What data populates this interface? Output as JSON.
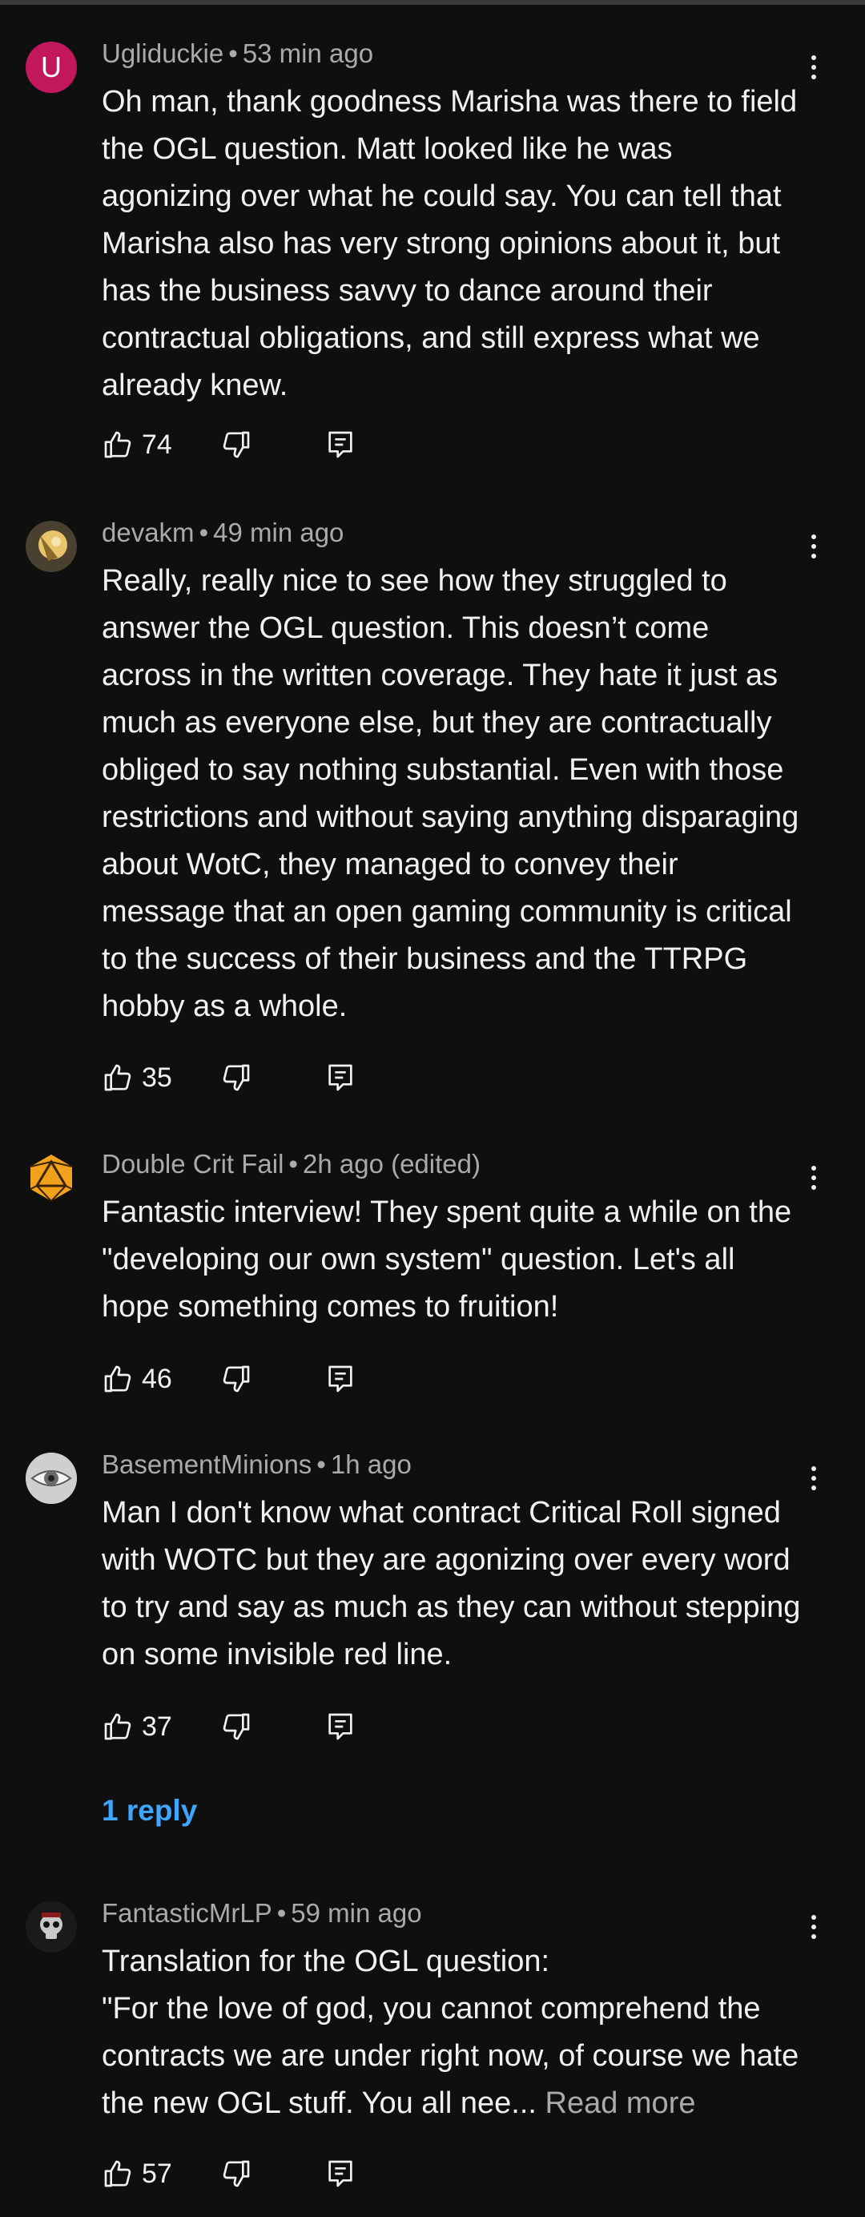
{
  "comments": [
    {
      "author": "Ugliduckie",
      "time": "53 min ago",
      "avatar_letter": "U",
      "text": "Oh man, thank goodness Marisha was there to field the OGL question. Matt looked like he was agonizing over what he could say. You can tell that Marisha also has very strong opinions about it, but has the business savvy to dance around their contractual obligations, and still express what we already knew.",
      "likes": "74"
    },
    {
      "author": "devakm",
      "time": "49 min ago",
      "text": "Really, really nice to see how they struggled to answer the OGL question. This doesn’t come across in the written coverage. They hate it just as much as everyone else, but they are contractually obliged to say nothing substantial. Even with those restrictions and without saying anything disparaging about WotC, they managed to convey their message that an open gaming community is critical to the success of their business and the TTRPG hobby as a whole.",
      "likes": "35"
    },
    {
      "author": "Double Crit Fail",
      "time": "2h ago (edited)",
      "text": "Fantastic interview! They spent quite a while on the \"developing our own system\" question. Let's all hope something comes to fruition!",
      "likes": "46"
    },
    {
      "author": "BasementMinions",
      "time": "1h ago",
      "text": "Man I don't know what contract Critical Roll signed with WOTC but they are agonizing over every word to try and say as much as they can without stepping on some invisible red line.",
      "likes": "37",
      "replies": "1 reply"
    },
    {
      "author": "FantasticMrLP",
      "time": "59 min ago",
      "text_line1": "Translation for the OGL question:",
      "text_rest": "\"For the love of god, you cannot comprehend the contracts we are under right now, of course we hate the new OGL stuff. You all nee...",
      "read_more": "Read more",
      "likes": "57"
    }
  ],
  "meta_separator": "•",
  "colors": {
    "background": "#0f0f0f",
    "text": "#f1f1f1",
    "meta": "#aaaaaa",
    "link": "#3ea6ff",
    "avatar_u": "#c2185b"
  },
  "icons": [
    "like-icon",
    "dislike-icon",
    "reply-icon",
    "more-options-icon"
  ]
}
